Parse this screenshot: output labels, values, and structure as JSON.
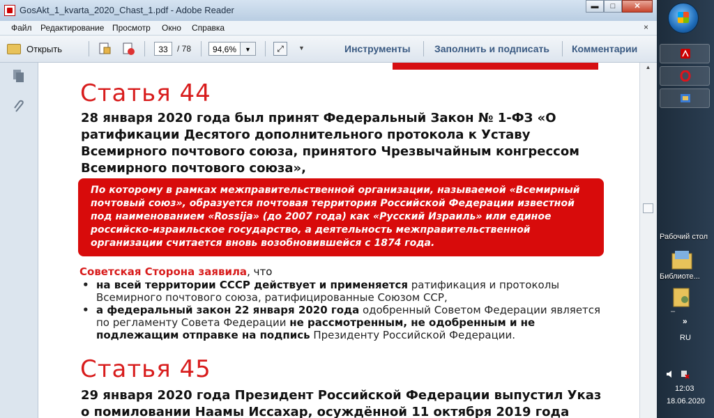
{
  "window": {
    "title": "GosAkt_1_kvarta_2020_Chast_1.pdf - Adobe Reader",
    "min": "▬",
    "max": "□",
    "close": "✕"
  },
  "menu": {
    "items": [
      "Файл",
      "Редактирование",
      "Просмотр",
      "Окно",
      "Справка"
    ],
    "close": "×"
  },
  "toolbar": {
    "open_label": "Открыть",
    "page_current": "33",
    "page_total": "/ 78",
    "zoom": "94,6%",
    "tools_label": "Инструменты",
    "fill_sign_label": "Заполнить и подписать",
    "comments_label": "Комментарии"
  },
  "document": {
    "article44": "Статья 44",
    "article44_lead": "28 января 2020 года был принят Федеральный Закон № 1-ФЗ «О ратификации Десятого дополнительного протокола к Уставу Всемирного почтового союза, принятого Чрезвычайным конгрессом Всемирного почтового союза»,",
    "redbox_text": "По которому в рамках межправительственной организации, называемой «Всемирный почтовый союз», образуется почтовая территория Российской Федерации известной под наименованием «Rossija» (до 2007 года) как «Русский Израиль» или единое российско-израильское государство, а деятельность межправительственной организации считается вновь возобновившейся с 1874 года.",
    "stmt_highlight": "Советская Сторона заявила",
    "stmt_rest": ", что",
    "bullet1_bold": "на всей территории СССР действует и применяется",
    "bullet1_rest": " ратификация и протоколы Всемирного почтового союза, ратифицированные Союзом ССР,",
    "bullet2_bold": "а федеральный закон 22 января 2020 года",
    "bullet2_mid": " одобренный Советом Федерации является по регламенту Совета Федерации ",
    "bullet2_bold2": "не рассмотренным, не одобренным и не подлежащим отправке на подпись",
    "bullet2_end": " Президенту Российской Федерации.",
    "article45": "Статья 45",
    "article45_lead": "29 января 2020 года Президент Российской Федерации выпустил Указ о помиловании Наамы Иссахар, осуждённой 11 октября 2019 года"
  },
  "desktop": {
    "label_desktop": "Рабочий стол",
    "label_library": "Библиоте...",
    "label_user": "–"
  },
  "tray": {
    "lang": "RU",
    "time": "12:03",
    "date": "18.06.2020",
    "expand": "»"
  },
  "colors": {
    "accent_red": "#d81c1c",
    "box_red": "#d80b0b",
    "link_blue": "#3a5a82"
  }
}
